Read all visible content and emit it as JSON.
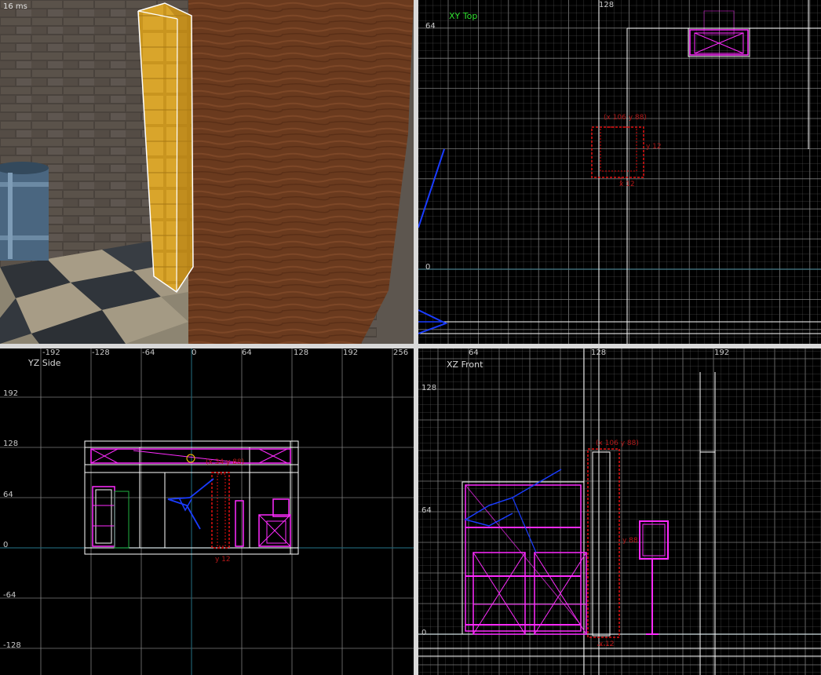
{
  "viewports": {
    "camera": {
      "frame_time": "16 ms"
    },
    "xy_top": {
      "title": "XY Top",
      "title_color": "#30e030",
      "ruler_top": [
        "128"
      ],
      "ruler_left": [
        "64",
        "0"
      ],
      "selection_label_top": "(x 106  y 88)",
      "selection_label_right": "y 12",
      "selection_label_bottom": "x 12"
    },
    "yz_side": {
      "title": "YZ Side",
      "ruler_top": [
        "-192",
        "-128",
        "-64",
        "0",
        "64",
        "128",
        "192",
        "256"
      ],
      "ruler_left": [
        "192",
        "128",
        "64",
        "0",
        "-64",
        "-128"
      ],
      "selection_label_top": "(x 34  y 88)",
      "selection_label_bottom": "y 12"
    },
    "xz_front": {
      "title": "XZ Front",
      "ruler_top": [
        "64",
        "128",
        "192"
      ],
      "ruler_left": [
        "128",
        "64",
        "0"
      ],
      "selection_label_top": "(x 106  y 88)",
      "selection_label_right": "y 88",
      "selection_label_bottom": "x 12"
    }
  },
  "colors": {
    "grid": "#5a5a5a",
    "grid_major": "#8a8a8a",
    "grid_1024": "#ffffff",
    "axis": "#1f5f6f",
    "brush": "#ff2bff",
    "brush_white": "#ffffff",
    "selection": "#e01010",
    "entity_blue": "#1a3cff",
    "entity_green": "#20b040"
  }
}
